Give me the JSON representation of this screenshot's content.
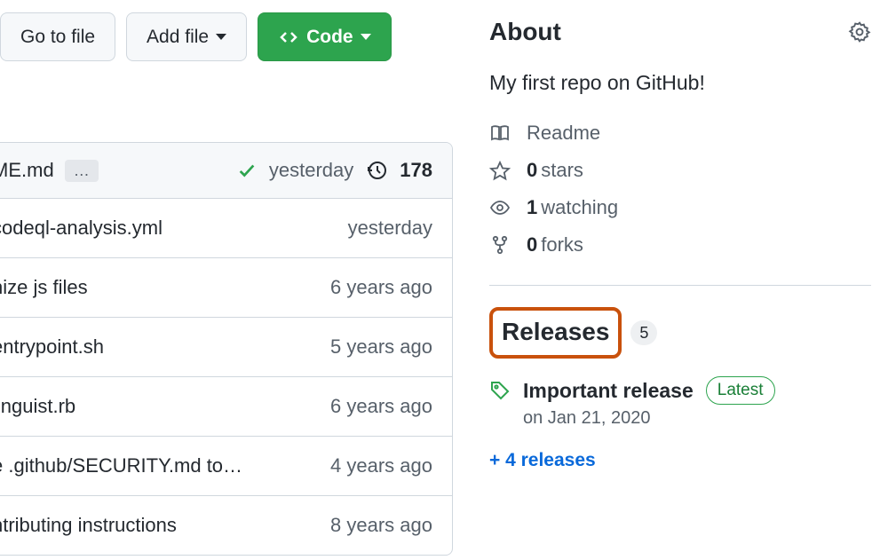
{
  "toolbar": {
    "go_to_file": "Go to file",
    "add_file": "Add file",
    "code": "Code"
  },
  "files": {
    "header": {
      "filename": "ME.md",
      "ellipsis": "…",
      "time": "yesterday",
      "commit_count": "178"
    },
    "rows": [
      {
        "name": "codeql-analysis.yml",
        "time": "yesterday"
      },
      {
        "name": "nize js files",
        "time": "6 years ago"
      },
      {
        "name": "entrypoint.sh",
        "time": "5 years ago"
      },
      {
        "name": "linguist.rb",
        "time": "6 years ago"
      },
      {
        "name": "e .github/SECURITY.md to…",
        "time": "4 years ago"
      },
      {
        "name": "ntributing instructions",
        "time": "8 years ago"
      }
    ]
  },
  "about": {
    "heading": "About",
    "description": "My first repo on GitHub!",
    "readme": "Readme",
    "stars_count": "0",
    "stars_label": "stars",
    "watching_count": "1",
    "watching_label": "watching",
    "forks_count": "0",
    "forks_label": "forks"
  },
  "releases": {
    "heading": "Releases",
    "count": "5",
    "latest": {
      "title": "Important release",
      "badge": "Latest",
      "date": "on Jan 21, 2020"
    },
    "more": "+ 4 releases"
  }
}
